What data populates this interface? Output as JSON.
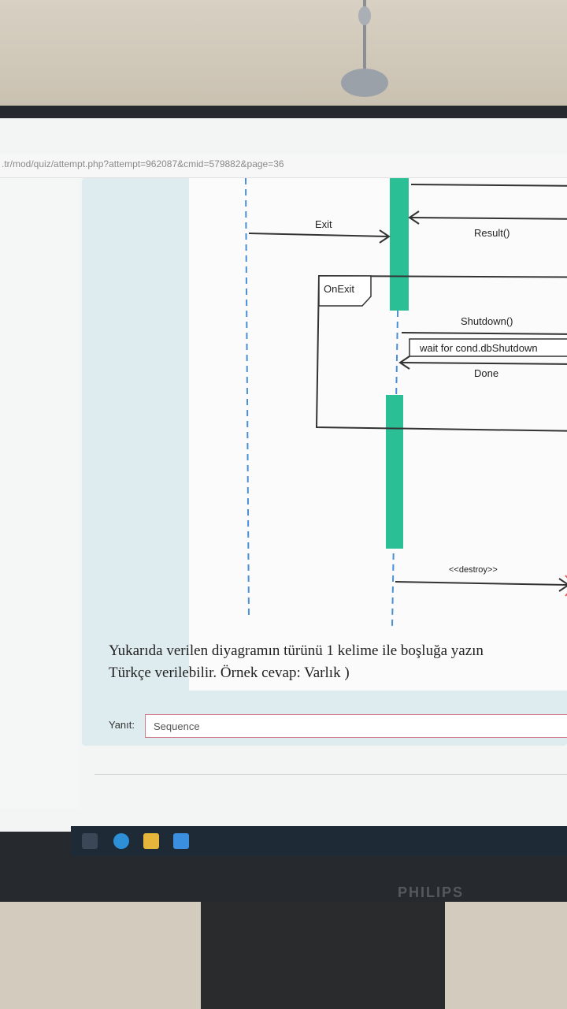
{
  "browser": {
    "url": ".tr/mod/quiz/attempt.php?attempt=962087&cmid=579882&page=36"
  },
  "diagram": {
    "messages": {
      "exit": "Exit",
      "result": "Result()",
      "shutdown": "Shutdown()",
      "wait": "wait for cond.dbShutdown",
      "done": "Done",
      "destroy": "<<destroy>>"
    },
    "fragment_label": "OnExit",
    "activation_color": "#2bbf96"
  },
  "question": {
    "line1": "Yukarıda verilen diyagramın türünü 1 kelime ile boşluğa yazın",
    "line2": "Türkçe verilebilir. Örnek cevap:   Varlık )"
  },
  "answer": {
    "label": "Yanıt:",
    "value": "Sequence"
  },
  "monitor": {
    "brand": "PHILIPS"
  }
}
